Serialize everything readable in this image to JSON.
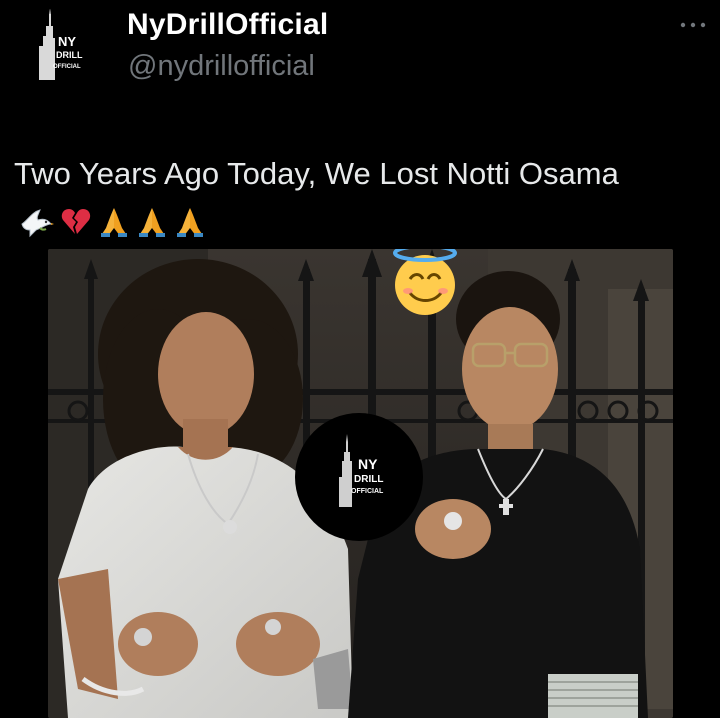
{
  "account": {
    "display_name": "NyDrillOfficial",
    "handle": "@nydrillofficial",
    "avatar_logo_lines": [
      "NY",
      "DRILL",
      "OFFICIAL"
    ]
  },
  "tweet": {
    "text": "Two Years Ago Today, We Lost Notti Osama",
    "emojis": [
      "dove-emoji",
      "broken-heart-emoji",
      "folded-hands-emoji",
      "folded-hands-emoji",
      "folded-hands-emoji"
    ]
  },
  "media": {
    "watermark_logo_lines": [
      "NY",
      "DRILL",
      "OFFICIAL"
    ],
    "overlay_emoji": "smiling-face-with-halo-emoji"
  },
  "colors": {
    "background": "#000000",
    "text_primary": "#e7e9ea",
    "text_secondary": "#71767b"
  },
  "icons": {
    "more": "more-options-icon"
  }
}
